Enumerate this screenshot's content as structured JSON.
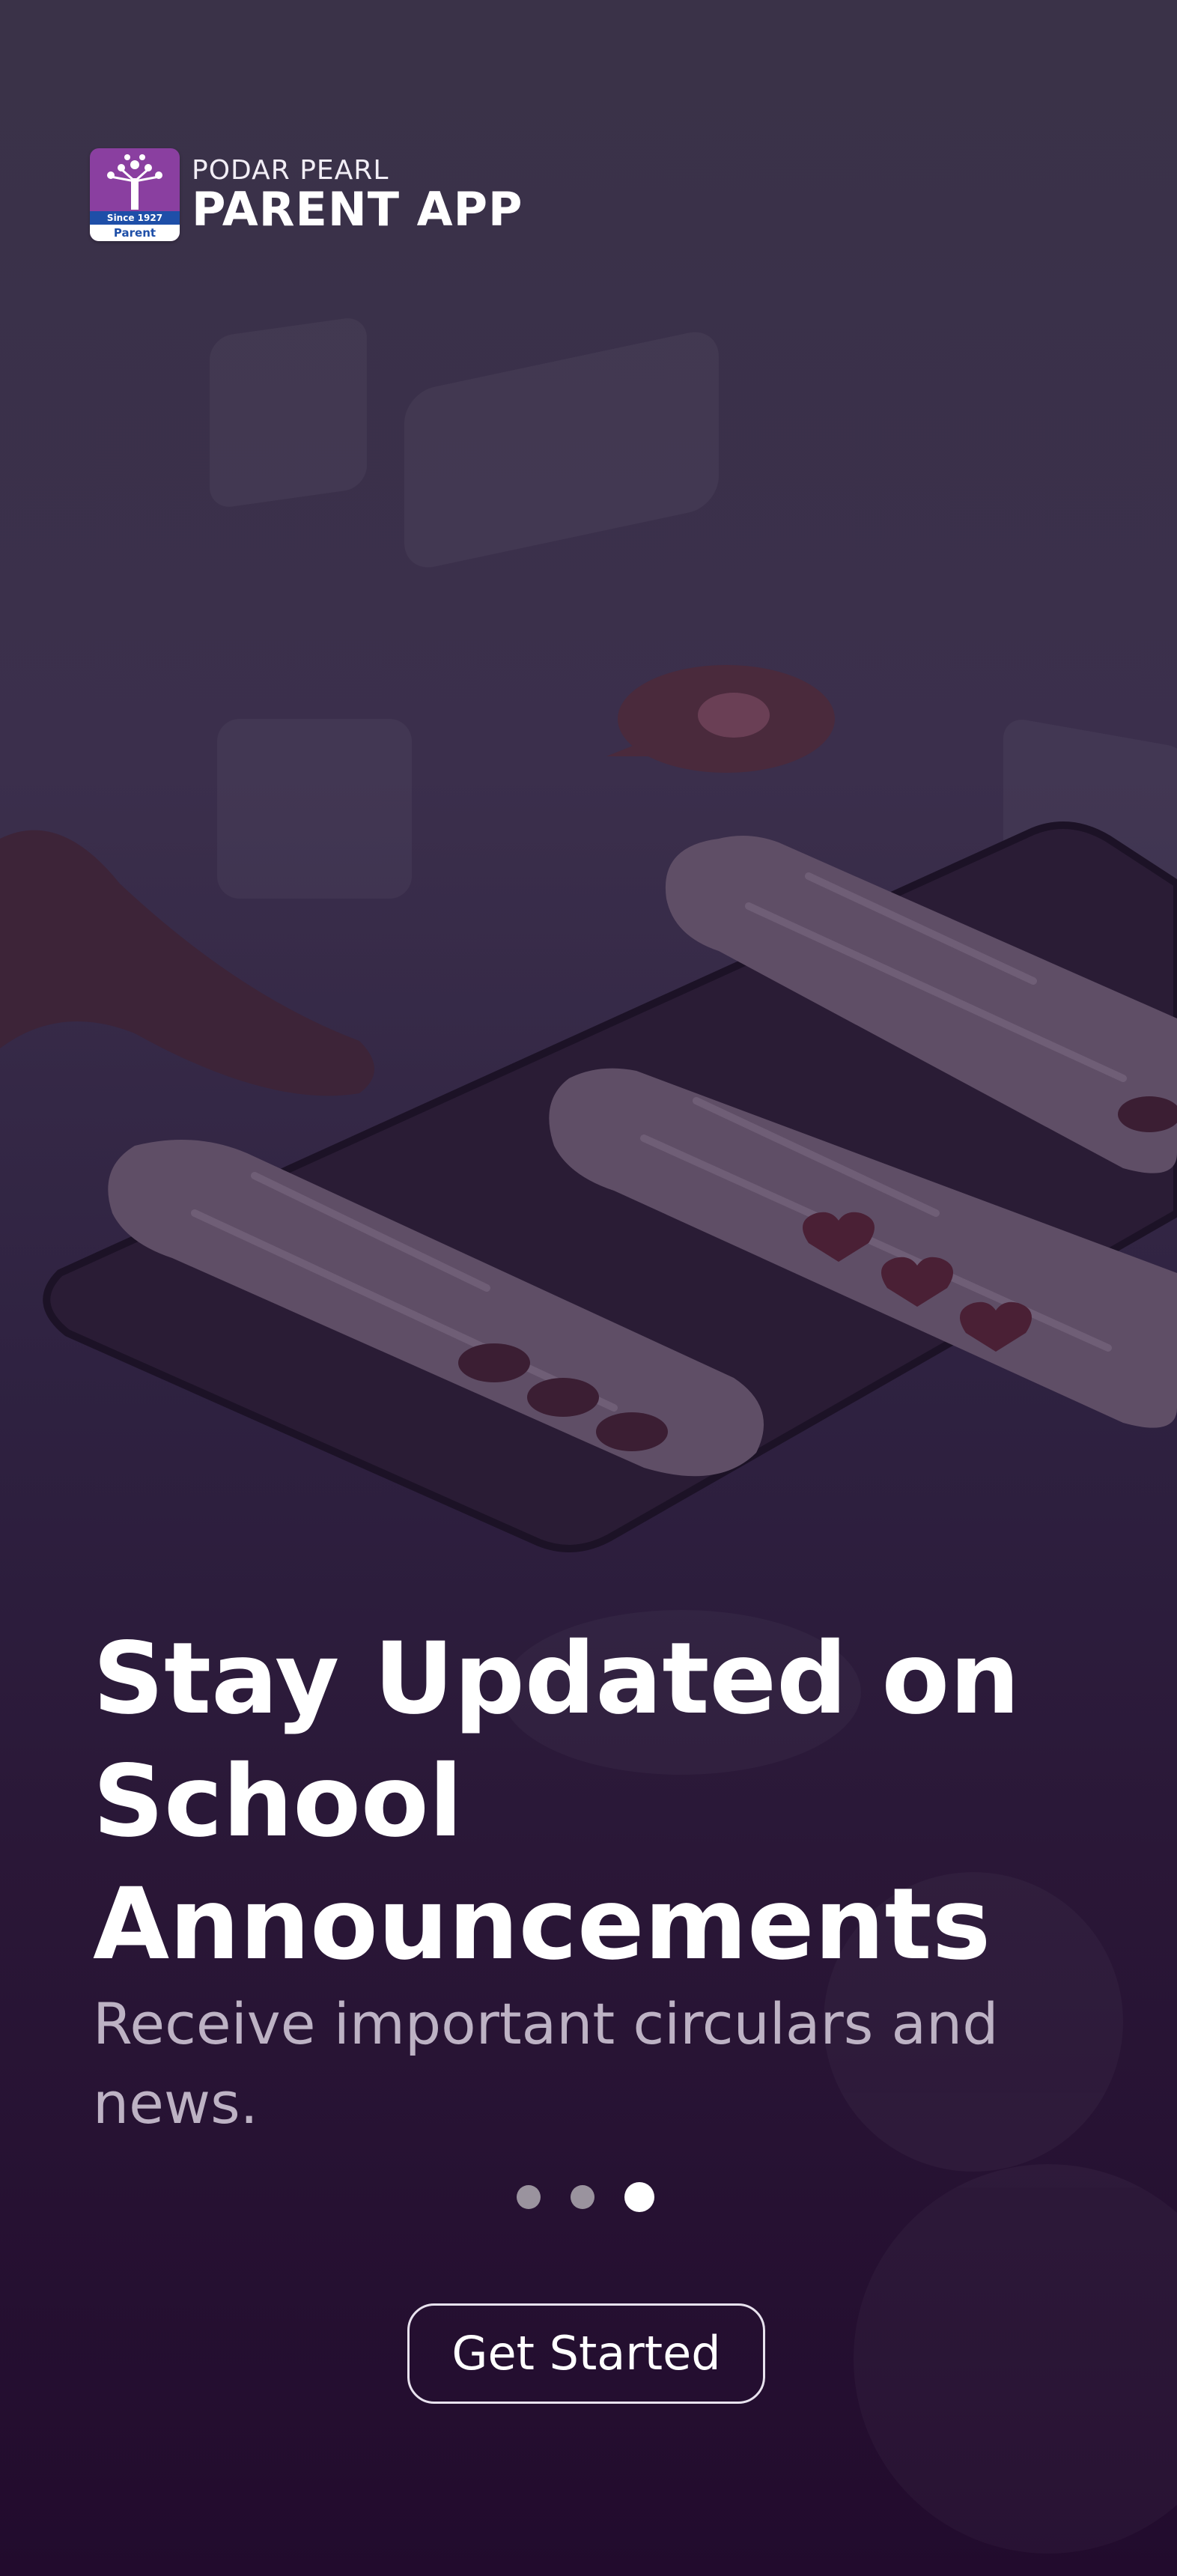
{
  "brand": {
    "line1": "PODAR PEARL",
    "line2": "PARENT APP",
    "logo_since": "Since 1927",
    "logo_label": "Parent"
  },
  "slide": {
    "title": "Stay Updated on School Announcements",
    "subtitle": "Receive important circulars and news.",
    "total_pages": 3,
    "active_page": 3
  },
  "cta": {
    "label": "Get Started"
  },
  "colors": {
    "bg_top": "#3a3248",
    "bg_bottom": "#220b2d",
    "bubble": "#5f4e66",
    "logo_purple": "#8a3fa0",
    "logo_blue": "#1e4fa8",
    "dot_inactive": "#9a939e",
    "dot_active": "#ffffff"
  },
  "icons": [
    "tree-logo-icon",
    "chat-bubble-icon",
    "heart-icon",
    "emoji-icon"
  ]
}
